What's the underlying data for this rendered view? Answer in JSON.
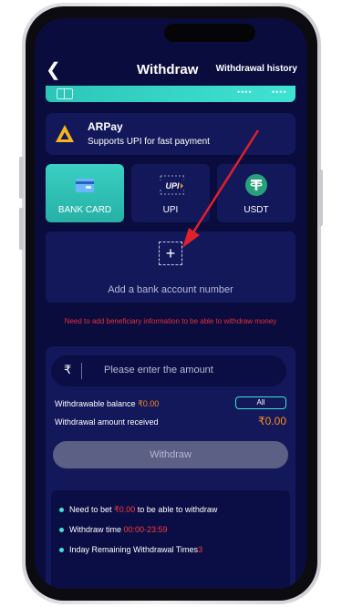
{
  "header": {
    "title": "Withdraw",
    "history": "Withdrawal history"
  },
  "card": {
    "masked_1": "••••",
    "masked_2": "••••"
  },
  "payment": {
    "name": "ARPay",
    "description": "Supports UPI for fast payment"
  },
  "methods": [
    {
      "label": "BANK CARD"
    },
    {
      "label": "UPI"
    },
    {
      "label": "USDT"
    }
  ],
  "add_account": {
    "label": "Add a bank account number"
  },
  "warning": "Need to add beneficiary information to be able to withdraw money",
  "amount": {
    "currency_symbol": "₹",
    "placeholder": "Please enter the amount"
  },
  "balance": {
    "label": "Withdrawable balance ",
    "value": "₹0.00",
    "all_label": "All"
  },
  "received": {
    "label": "Withdrawal amount received",
    "value": "₹0.00"
  },
  "withdraw_button": "Withdraw",
  "rules": {
    "bet_prefix": "Need to bet ",
    "bet_value": "₹0.00",
    "bet_suffix": " to be able to withdraw",
    "time_prefix": "Withdraw time ",
    "time_value": "00:00-23:59",
    "times_prefix": "Inday Remaining Withdrawal Times",
    "times_value": "3"
  },
  "colors": {
    "background": "#0a0c3e",
    "card": "#13185a",
    "accent": "#3fe3d2",
    "orange": "#ff8a1e",
    "red": "#e3303b"
  }
}
